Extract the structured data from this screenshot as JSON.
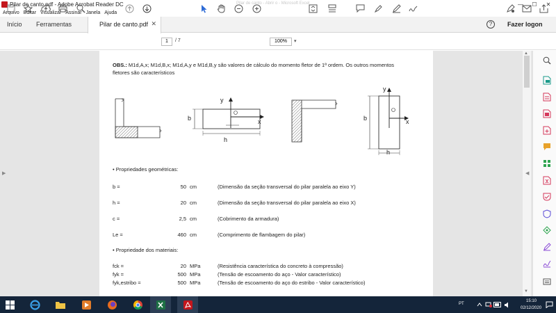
{
  "window": {
    "title": "Pilar de canto.pdf - Adobe Acrobat Reader DC",
    "faded_title": "Pilar de canto - Abrir o - Microsoft Excel",
    "controls": {
      "minimize": "—",
      "maximize": "☐",
      "close": "✕"
    }
  },
  "menu": [
    "Arquivo",
    "Editar",
    "Visualizar",
    "Assinar",
    "Janela",
    "Ajuda"
  ],
  "tabs": {
    "home": "Início",
    "tools": "Ferramentas",
    "document": "Pilar de canto.pdf",
    "close": "✕",
    "login": "Fazer logon",
    "help": "?"
  },
  "toolbar": {
    "page_current": "1",
    "page_total": "/  7",
    "zoom": "100%",
    "zoom_arrow": "▾"
  },
  "content": {
    "obs_bold": "OBS.:",
    "obs_text": " M1d,A,x; M1d,B,x; M1d,A,y e M1d,B,y são valores de cálculo do momento fletor de 1ª ordem. Os outros momentos fletores são característicos",
    "diagram_labels": {
      "b": "b",
      "h": "h",
      "x": "x",
      "y": "y"
    },
    "sections": {
      "geom": "• Propriedades geométricas:",
      "materials": "• Propriedade dos materiais:"
    },
    "geom_rows": [
      {
        "name": "b =",
        "value": "50",
        "unit": "cm",
        "desc": "(Dimensão da seção transversal do pilar paralela ao eixo Y)"
      },
      {
        "name": "h =",
        "value": "20",
        "unit": "cm",
        "desc": "(Dimensão da seção transversal do pilar paralela ao eixo X)"
      },
      {
        "name": "c =",
        "value": "2,5",
        "unit": "cm",
        "desc": "(Cobrimento da armadura)"
      },
      {
        "name": "Le =",
        "value": "460",
        "unit": "cm",
        "desc": "(Comprimento de flambagem do pilar)"
      }
    ],
    "material_rows": [
      {
        "name": "fck =",
        "value": "20",
        "unit": "MPa",
        "desc": "(Resistência característica do concreto à compressão)"
      },
      {
        "name": "fyk =",
        "value": "500",
        "unit": "MPa",
        "desc": "(Tensão de escoamento do aço - Valor característico)"
      },
      {
        "name": "fyk,estribo =",
        "value": "500",
        "unit": "MPa",
        "desc": "(Tensão de escoamento do aço do estribo - Valor característico)"
      }
    ]
  },
  "taskbar": {
    "lang": "PT",
    "time": "15:10",
    "date": "02/12/2020"
  },
  "colors": {
    "accent_red": "#c4161c",
    "taskbar": "#14253a",
    "cursor_blue": "#2d6bd6"
  }
}
